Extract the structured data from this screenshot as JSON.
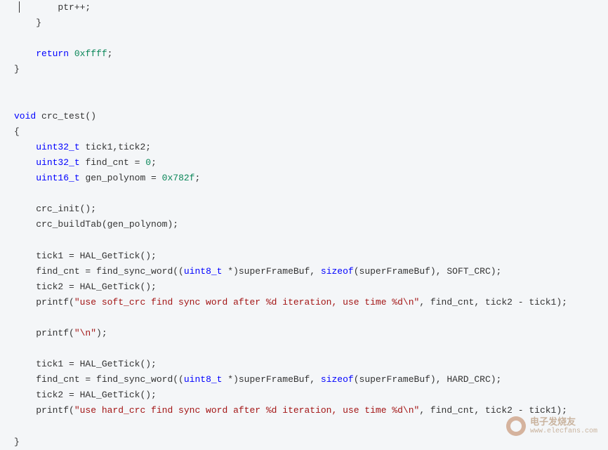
{
  "code": {
    "line1_text": "ptr++;",
    "line2_text": "}",
    "line3_text": "",
    "line4_return": "return",
    "line4_value": "0xffff",
    "line4_semi": ";",
    "line5_text": "}",
    "line6_text": "",
    "line7_text": "",
    "line8_void": "void",
    "line8_func": " crc_test()",
    "line9_text": "{",
    "line10_type": "uint32_t",
    "line10_text": " tick1,tick2;",
    "line11_type": "uint32_t",
    "line11_text": " find_cnt = ",
    "line11_value": "0",
    "line11_semi": ";",
    "line12_type": "uint16_t",
    "line12_text": " gen_polynom = ",
    "line12_value": "0x782f",
    "line12_semi": ";",
    "line13_text": "",
    "line14_text": "crc_init();",
    "line15_text": "crc_buildTab(gen_polynom);",
    "line16_text": "",
    "line17_text": "tick1 = HAL_GetTick();",
    "line18_a": "find_cnt = find_sync_word((",
    "line18_type": "uint8_t",
    "line18_b": " *)superFrameBuf, ",
    "line18_sizeof": "sizeof",
    "line18_c": "(superFrameBuf), SOFT_CRC);",
    "line19_text": "tick2 = HAL_GetTick();",
    "line20_a": "printf(",
    "line20_str": "\"use soft_crc find sync word after %d iteration, use time %d\\n\"",
    "line20_b": ", find_cnt, tick2 - tick1);",
    "line21_text": "",
    "line22_a": "printf(",
    "line22_str": "\"\\n\"",
    "line22_b": ");",
    "line23_text": "",
    "line24_text": "tick1 = HAL_GetTick();",
    "line25_a": "find_cnt = find_sync_word((",
    "line25_type": "uint8_t",
    "line25_b": " *)superFrameBuf, ",
    "line25_sizeof": "sizeof",
    "line25_c": "(superFrameBuf), HARD_CRC);",
    "line26_text": "tick2 = HAL_GetTick();",
    "line27_a": "printf(",
    "line27_str": "\"use hard_crc find sync word after %d iteration, use time %d\\n\"",
    "line27_b": ", find_cnt, tick2 - tick1);",
    "line28_text": "",
    "line29_text": "}"
  },
  "watermark": {
    "cn": "电子发烧友",
    "url": "www.elecfans.com"
  }
}
